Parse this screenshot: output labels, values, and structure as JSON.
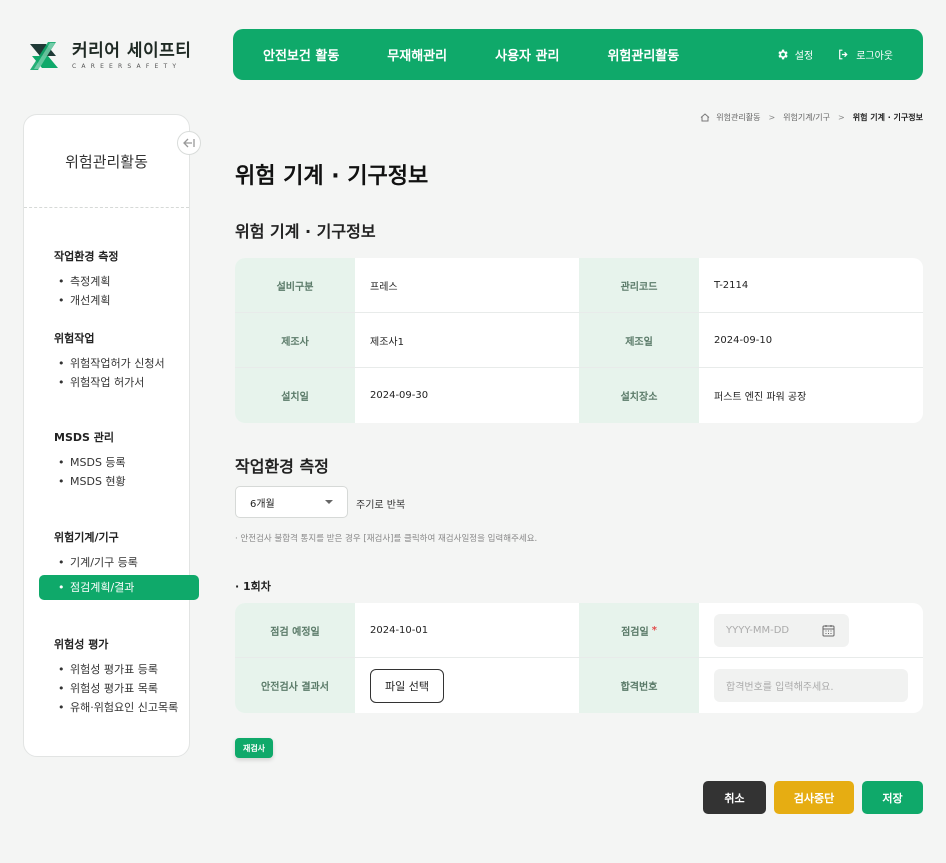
{
  "logo": {
    "name": "커리어 세이프티",
    "sub": "CAREERSAFETY"
  },
  "topnav": {
    "items": [
      "안전보건 활동",
      "무재해관리",
      "사용자 관리",
      "위험관리활동"
    ]
  },
  "topbar": {
    "settings": "설정",
    "logout": "로그아웃"
  },
  "sidebar": {
    "title": "위험관리활동",
    "groups": [
      {
        "title": "작업환경 측정",
        "items": [
          "측정계획",
          "개선계획"
        ]
      },
      {
        "title": "위험작업",
        "items": [
          "위험작업허가 신청서",
          "위험작업 허가서"
        ]
      },
      {
        "title": "MSDS 관리",
        "items": [
          "MSDS 등록",
          "MSDS 현황"
        ]
      },
      {
        "title": "위험기계/기구",
        "items": [
          "기계/기구 등록",
          "점검계획/결과"
        ]
      },
      {
        "title": "위험성 평가",
        "items": [
          "위험성 평가표 등록",
          "위험성 평가표 목록",
          "유해·위험요인 신고목록"
        ]
      }
    ]
  },
  "breadcrumb": {
    "items": [
      "위험관리활동",
      "위험기계/기구",
      "위험 기계 · 기구정보"
    ]
  },
  "page": {
    "title": "위험 기계 · 기구정보",
    "section1": "위험 기계 · 기구정보",
    "section2": "작업환경 측정"
  },
  "info": {
    "labels": [
      "설비구분",
      "관리코드",
      "제조사",
      "제조일",
      "설치일",
      "설치장소"
    ],
    "values": [
      "프레스",
      "T-2114",
      "제조사1",
      "2024-09-10",
      "2024-09-30",
      "퍼스트 엔진 파워 공장"
    ]
  },
  "cycle": {
    "selected": "6개월",
    "suffix": "주기로 반복"
  },
  "notice": "· 안전검사 불합격 통지를 받은 경우 [재검사]를 클릭하여 재검사일정을 입력해주세요.",
  "round": {
    "title": "· 1회차",
    "planned_label": "점검 예정일",
    "planned_value": "2024-10-01",
    "inspect_label": "점검일",
    "inspect_placeholder": "YYYY-MM-DD",
    "result_label": "안전검사 결과서",
    "file_button": "파일 선택",
    "pass_label": "합격번호",
    "pass_placeholder": "합격번호를 입력해주세요.",
    "required_mark": "*"
  },
  "buttons": {
    "recheck": "재검사",
    "cancel": "취소",
    "stop": "검사중단",
    "save": "저장"
  },
  "colors": {
    "primary": "#0fa96a",
    "warning": "#e6ad12",
    "dark": "#333333",
    "label_bg": "#e7f3ec"
  }
}
